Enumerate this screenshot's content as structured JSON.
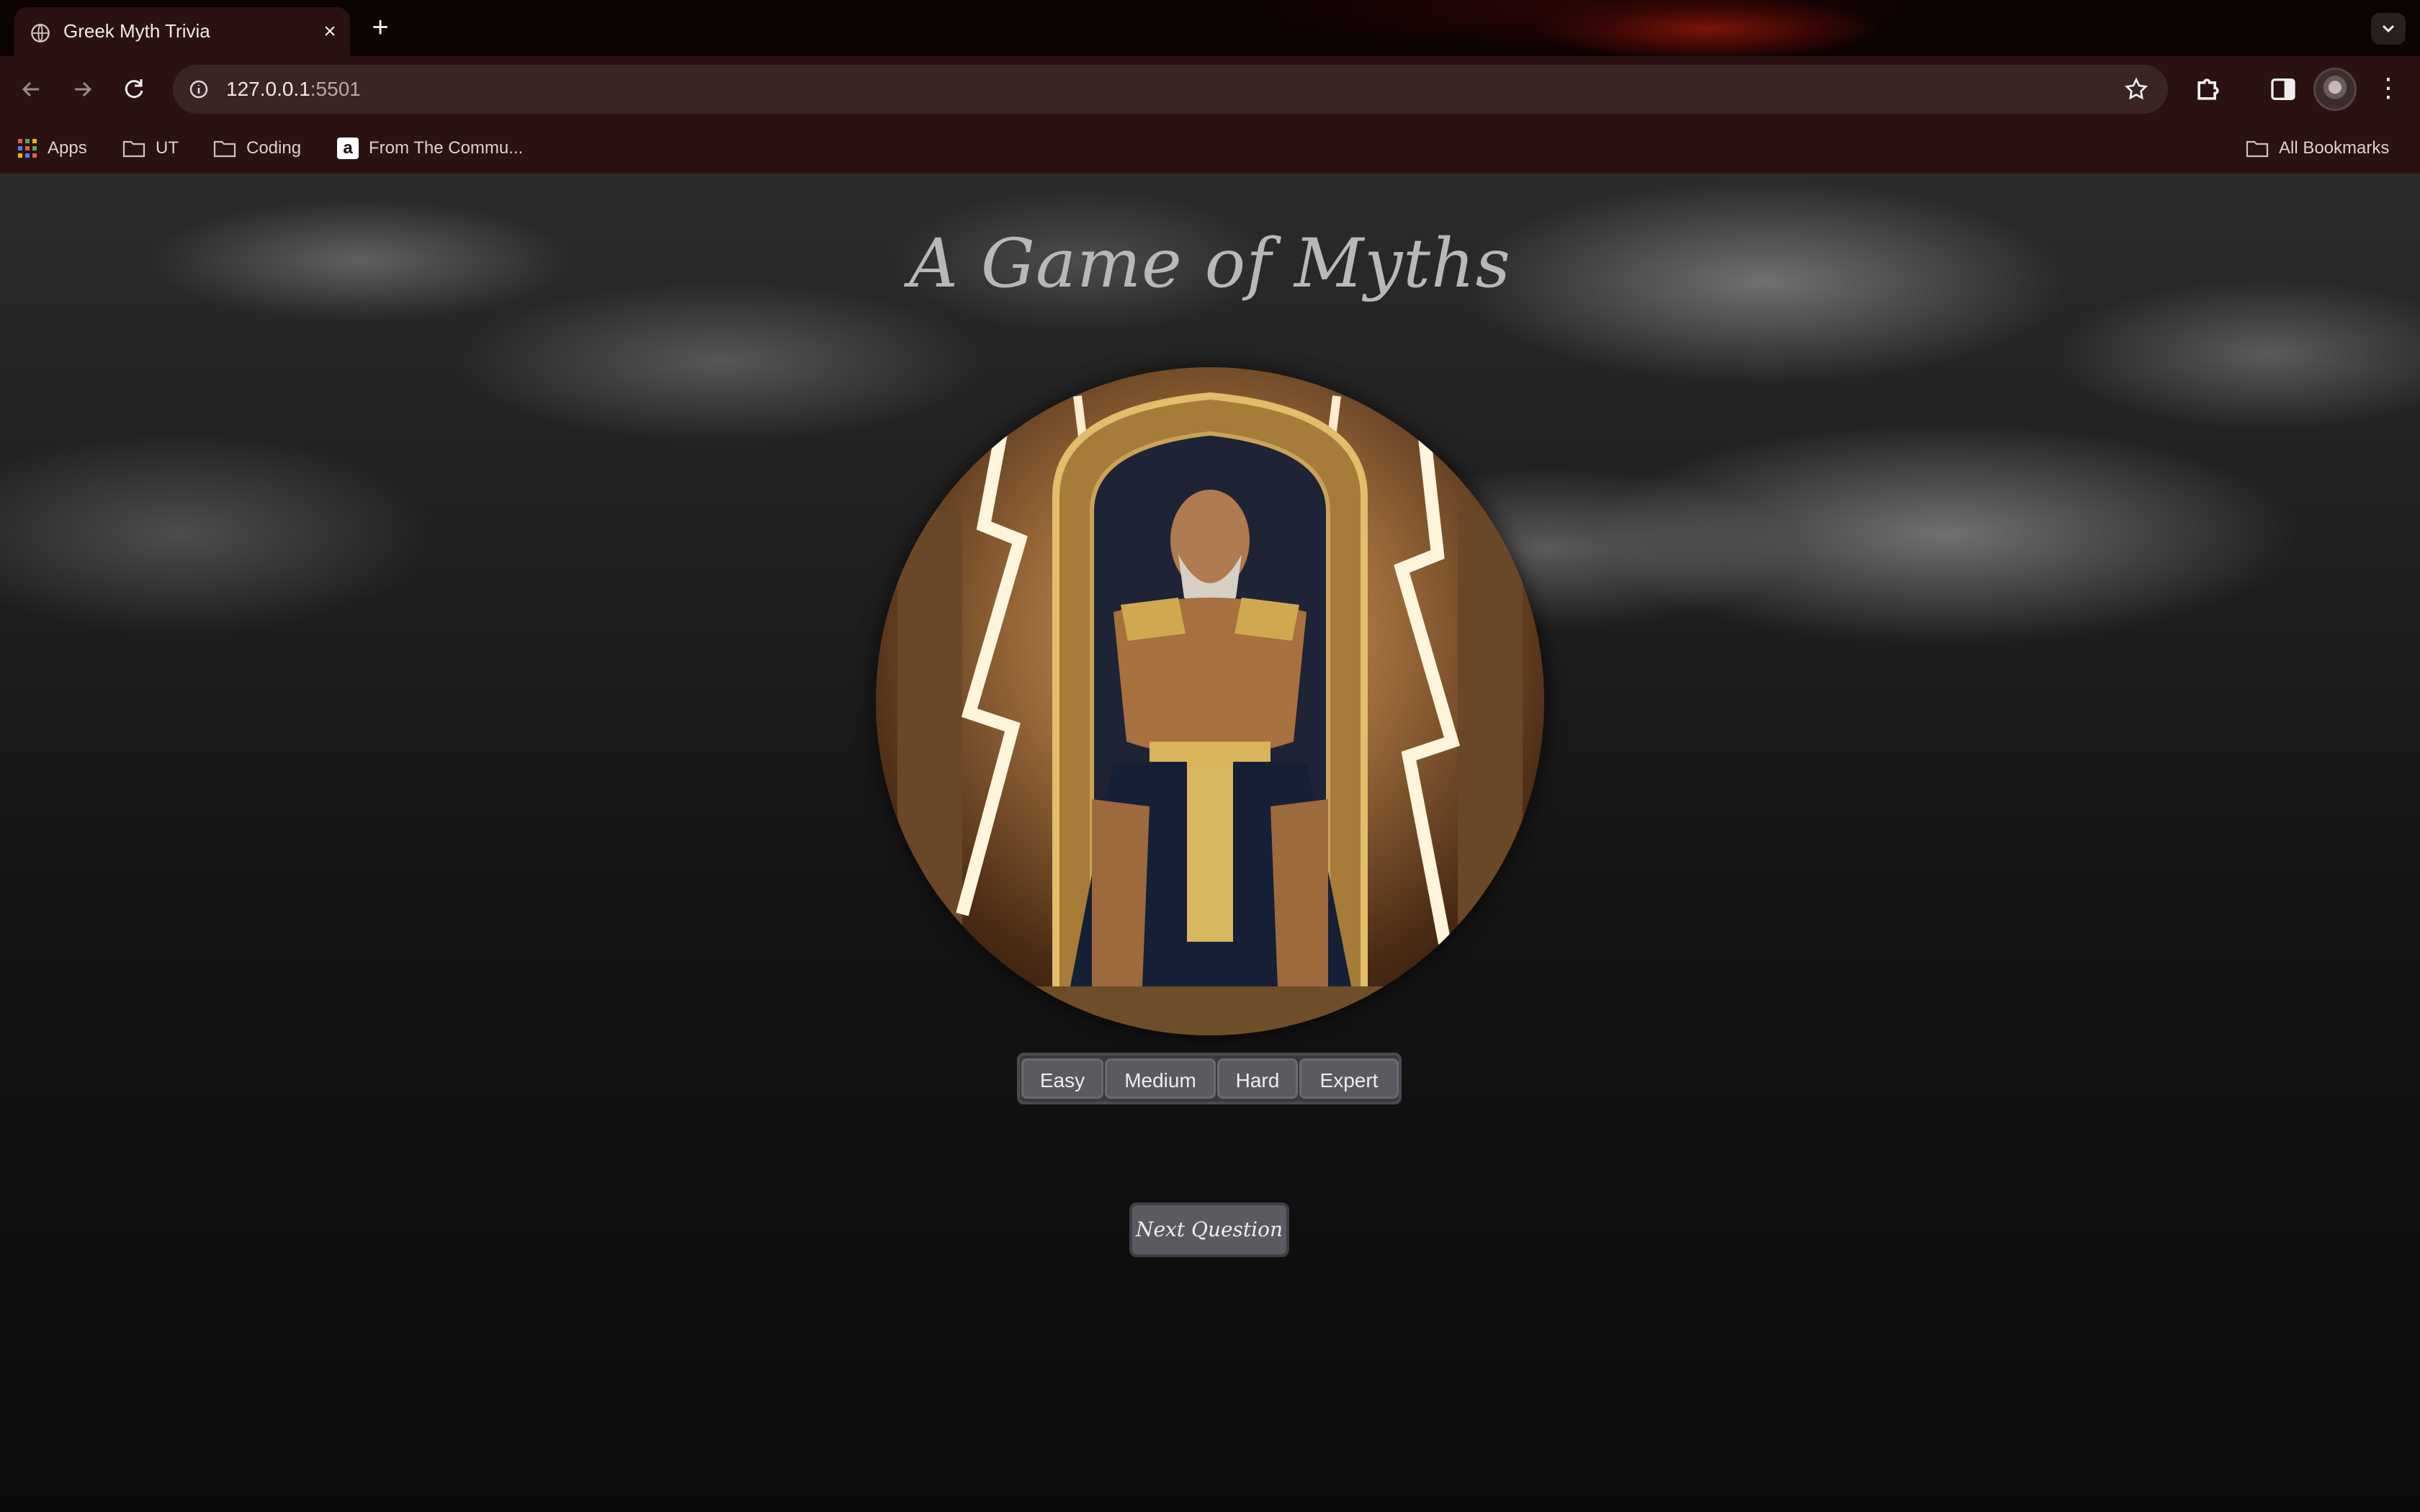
{
  "browser": {
    "tab": {
      "title": "Greek Myth Trivia",
      "close_icon": "×"
    },
    "new_tab_icon": "+",
    "address": {
      "host": "127.0.0.1",
      "port": ":5501"
    },
    "bookmarks": [
      {
        "label": "Apps",
        "icon": "apps-grid-icon"
      },
      {
        "label": "UT",
        "icon": "folder-icon"
      },
      {
        "label": "Coding",
        "icon": "folder-icon"
      },
      {
        "label": "From The Commu...",
        "icon": "amazon-icon"
      }
    ],
    "all_bookmarks": "All Bookmarks",
    "menu_icon": "⋮"
  },
  "page": {
    "title": "A Game of Myths",
    "image_alt": "Zeus seated on a golden throne with lightning",
    "difficulty": [
      "Easy",
      "Medium",
      "Hard",
      "Expert"
    ],
    "next_button": "Next Question"
  }
}
